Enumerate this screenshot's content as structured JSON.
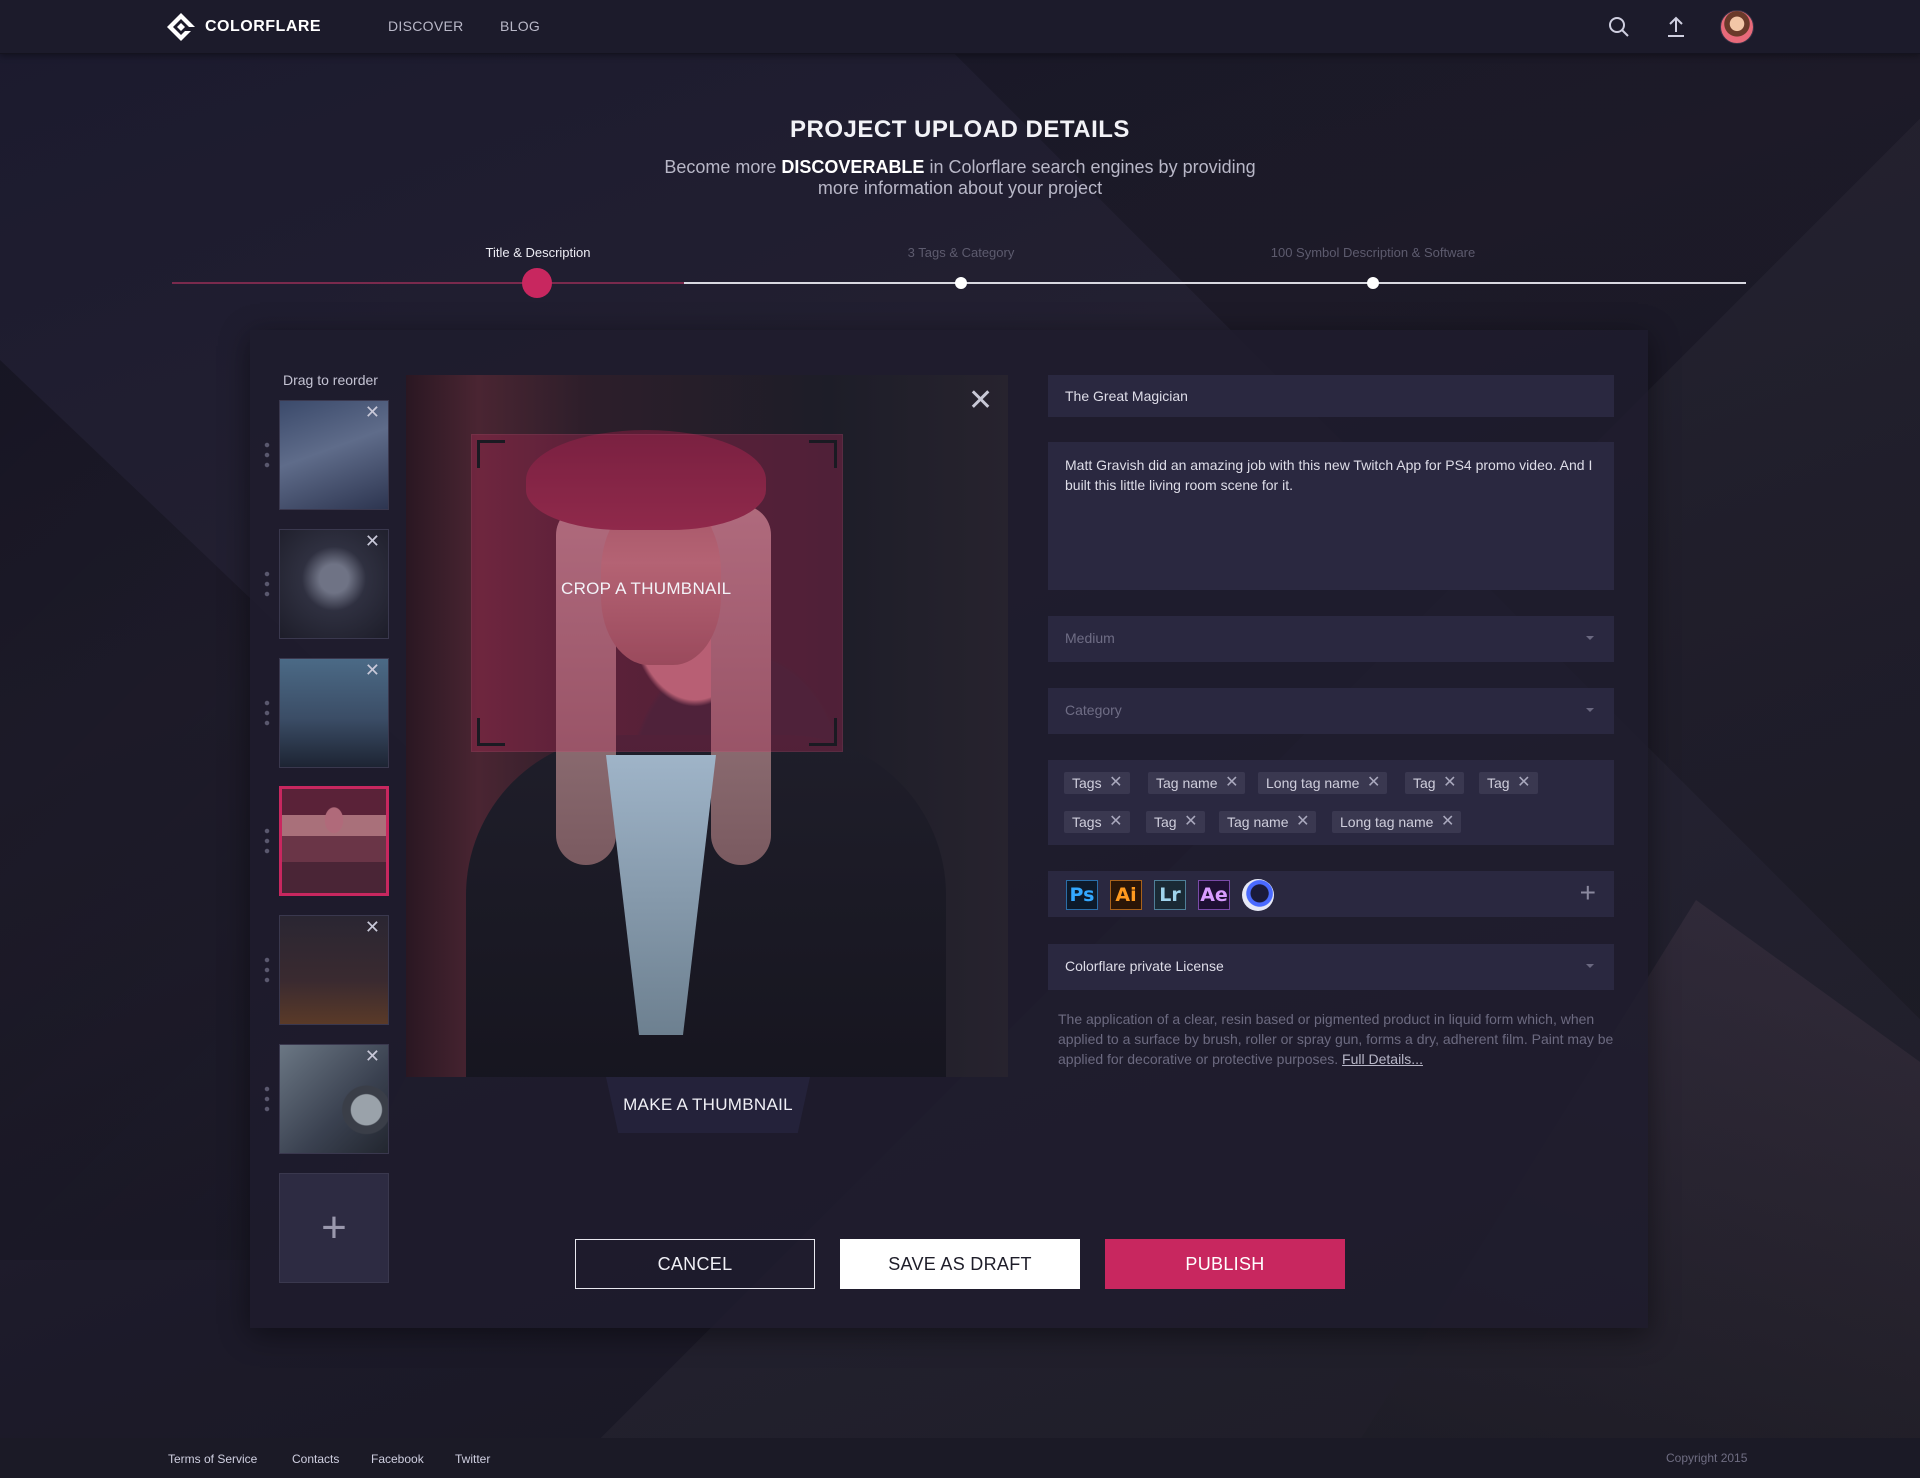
{
  "app": {
    "name": "COLORFLARE"
  },
  "nav": {
    "discover": "DISCOVER",
    "blog": "BLOG"
  },
  "header": {
    "title": "PROJECT UPLOAD DETAILS",
    "subtitle_prefix": "Become more ",
    "subtitle_emphasis": "DISCOVERABLE",
    "subtitle_suffix": " in Colorflare search engines by providing more information about your project"
  },
  "steps": [
    {
      "label": "Title & Description",
      "active": true
    },
    {
      "label": "3 Tags & Category",
      "active": false
    },
    {
      "label": "100 Symbol Description & Software",
      "active": false
    }
  ],
  "gallery": {
    "drag_label": "Drag to reorder",
    "thumbnails": [
      {
        "name": "thumbnail-1",
        "active": false
      },
      {
        "name": "thumbnail-2",
        "active": false
      },
      {
        "name": "thumbnail-3",
        "active": false
      },
      {
        "name": "thumbnail-4",
        "active": true
      },
      {
        "name": "thumbnail-5",
        "active": false
      },
      {
        "name": "thumbnail-6",
        "active": false
      }
    ],
    "add_label": "+",
    "close_glyph": "✕"
  },
  "editor": {
    "crop_label": "CROP A THUMBNAIL",
    "make_thumbnail_label": "MAKE A THUMBNAIL",
    "close_glyph": "✕"
  },
  "form": {
    "title_value": "The Great Magician",
    "description_value": "Matt Gravish did an amazing job with this new Twitch App for PS4 promo video. And I built this little living room scene for it.",
    "medium_placeholder": "Medium",
    "category_placeholder": "Category",
    "tags": [
      "Tags",
      "Tag name",
      "Long tag name",
      "Tag",
      "Tag",
      "Tags",
      "Tag",
      "Tag name",
      "Long tag name"
    ],
    "software": [
      {
        "label": "Ps",
        "icon": "photoshop-icon"
      },
      {
        "label": "Ai",
        "icon": "illustrator-icon"
      },
      {
        "label": "Lr",
        "icon": "lightroom-icon"
      },
      {
        "label": "Ae",
        "icon": "after-effects-icon"
      },
      {
        "label": "",
        "icon": "cinema4d-icon"
      }
    ],
    "license_value": "Colorflare private License",
    "license_text": "The application of a clear, resin based or pigmented product in liquid form which, when applied to a surface by brush, roller or spray gun, forms a dry, adherent film. Paint may be applied for decorative or protective purposes. ",
    "license_link": "Full Details..."
  },
  "actions": {
    "cancel": "CANCEL",
    "save_draft": "SAVE AS DRAFT",
    "publish": "PUBLISH"
  },
  "footer": {
    "links": [
      "Terms of Service",
      "Contacts",
      "Facebook",
      "Twitter"
    ],
    "copyright": "Copyright 2015"
  },
  "colors": {
    "accent": "#c8275f",
    "background": "#1b1a2e",
    "field": "#2a2840"
  }
}
